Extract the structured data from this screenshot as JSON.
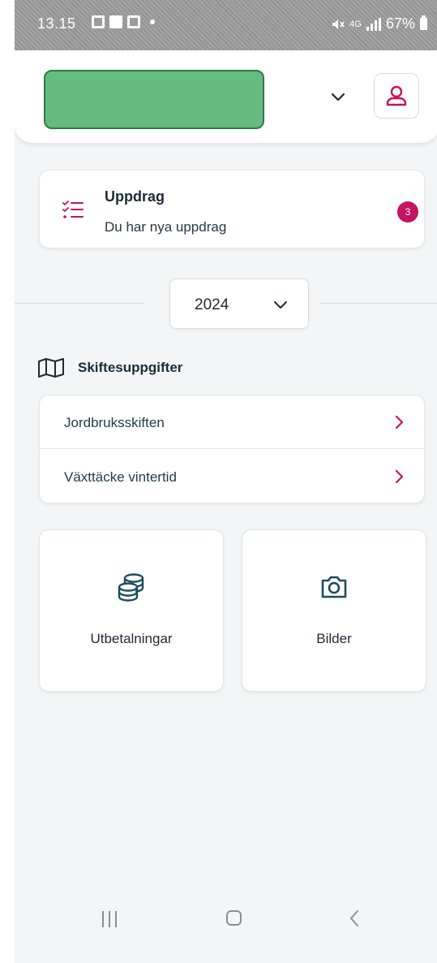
{
  "status_bar": {
    "time": "13.15",
    "signal": "4G",
    "battery": "67%"
  },
  "colors": {
    "accent": "#c4135f",
    "org_block": "#66bb80",
    "text_primary": "#1c2b36"
  },
  "uppdrag": {
    "title": "Uppdrag",
    "subtitle": "Du har nya uppdrag",
    "badge_count": "3",
    "icon": "checklist-icon"
  },
  "year_select": {
    "value": "2024"
  },
  "skiftesuppgifter": {
    "title": "Skiftesuppgifter",
    "icon": "map-icon",
    "items": [
      {
        "label": "Jordbruksskiften"
      },
      {
        "label": "Växttäcke vintertid"
      }
    ]
  },
  "tiles": [
    {
      "label": "Utbetalningar",
      "icon": "coins-icon"
    },
    {
      "label": "Bilder",
      "icon": "camera-icon"
    }
  ]
}
